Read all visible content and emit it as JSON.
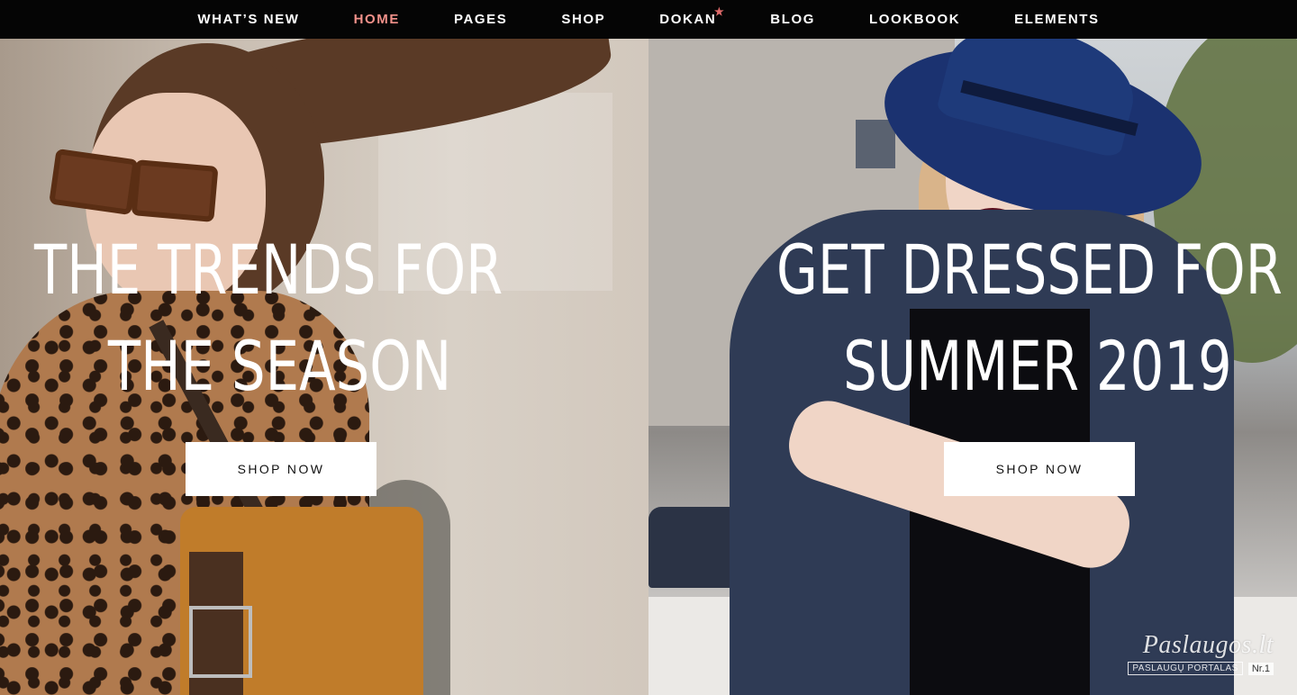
{
  "nav": {
    "items": [
      {
        "label": "WHAT’S NEW",
        "active": false
      },
      {
        "label": "HOME",
        "active": true
      },
      {
        "label": "PAGES",
        "active": false
      },
      {
        "label": "SHOP",
        "active": false
      },
      {
        "label": "DOKAN",
        "active": false,
        "badge_icon": "star-icon"
      },
      {
        "label": "BLOG",
        "active": false
      },
      {
        "label": "LOOKBOOK",
        "active": false
      },
      {
        "label": "ELEMENTS",
        "active": false
      }
    ],
    "active_color": "#f2918a",
    "badge_glyph": "★"
  },
  "slides": {
    "left": {
      "line1": "THE TRENDS FOR",
      "line2": "THE SEASON",
      "button": "SHOP NOW"
    },
    "right": {
      "line1": "GET DRESSED FOR",
      "line2": "SUMMER 2019",
      "button": "SHOP NOW"
    }
  },
  "watermark": {
    "main": "Paslaugos.lt",
    "sub": "PASLAUGŲ PORTALAS",
    "badge": "Nr.1"
  }
}
